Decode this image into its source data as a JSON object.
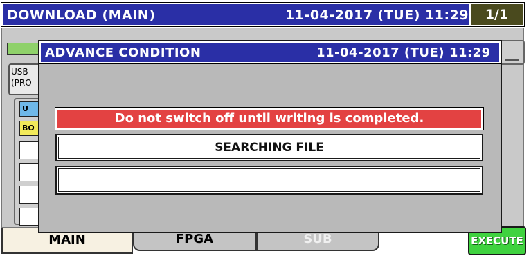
{
  "header": {
    "title": "DOWNLOAD (MAIN)",
    "datetime": "11-04-2017 (TUE)  11:29",
    "page": "1/1"
  },
  "background": {
    "usb_label": "USB\n(PRO",
    "chip_blue": "U",
    "chip_yellow": "BO"
  },
  "tabs": [
    {
      "label": "MAIN"
    },
    {
      "label": "FPGA"
    },
    {
      "label": "SUB"
    }
  ],
  "execute_label": "EXECUTE",
  "dialog": {
    "title": "ADVANCE CONDITION",
    "datetime": "11-04-2017 (TUE)  11:29",
    "warning": "Do not switch off until writing is completed.",
    "status": "SEARCHING FILE",
    "message": ""
  },
  "colors": {
    "title_bar": "#2a2fa6",
    "warning": "#e34242",
    "execute": "#3fd23f",
    "panel": "#c9c9c9"
  }
}
